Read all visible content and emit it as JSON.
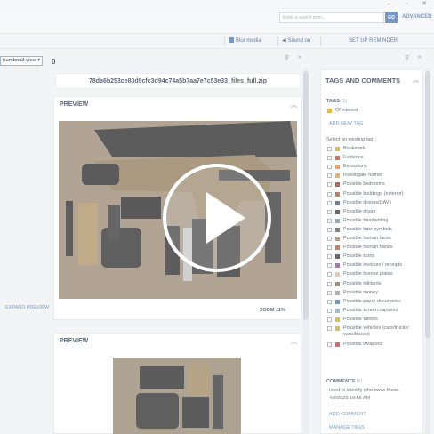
{
  "window": {
    "min": "–",
    "max": "▫",
    "close": "✕"
  },
  "search": {
    "placeholder": "Enter a search term...",
    "go_label": "GO",
    "advanced_label": "ADVANCED"
  },
  "toolbar": {
    "blur_media": "Blur media",
    "sound_on": "Sound on",
    "setup_reminder": "SET UP REMINDER"
  },
  "view_selector": {
    "value": "humbnail view"
  },
  "item_count": "0",
  "file": {
    "name": "78da6b253ce83d9cfc3d94c74a5b7aa7e7c53e33_files_full.zip"
  },
  "preview1": {
    "title": "PREVIEW",
    "expand_label": "EXPAND PREVIEW",
    "zoom_label": "ZOOM 11%"
  },
  "preview2": {
    "title": "PREVIEW"
  },
  "right_panel": {
    "title": "TAGS AND COMMENTS",
    "tags_label": "TAGS",
    "tags_count": "(1)",
    "applied_tag": "Of interest",
    "add_new_tag": "ADD NEW TAG",
    "select_existing": "Select an existing tag:",
    "tags": [
      {
        "label": "Bookmark",
        "color": "#d4a017"
      },
      {
        "label": "Evidence",
        "color": "#c0392b"
      },
      {
        "label": "Exceptions",
        "color": "#e67e22"
      },
      {
        "label": "Investigate further",
        "color": "#c9a227"
      },
      {
        "label": "Possible bedrooms",
        "color": "#8e2c2c"
      },
      {
        "label": "Possible buildings (exterior)",
        "color": "#8b5a2b"
      },
      {
        "label": "Possible drones/UAVs",
        "color": "#3b4c6b"
      },
      {
        "label": "Possible drugs",
        "color": "#2c2c2c"
      },
      {
        "label": "Possible handwriting",
        "color": "#6b8e9e"
      },
      {
        "label": "Possible hate symbols",
        "color": "#555555"
      },
      {
        "label": "Possible human faces",
        "color": "#9e7b5a"
      },
      {
        "label": "Possible human hands",
        "color": "#a05a2c"
      },
      {
        "label": "Possible icons",
        "color": "#2c2c2c"
      },
      {
        "label": "Possible invoices / receipts",
        "color": "#7b4a8e"
      },
      {
        "label": "Possible license plates",
        "color": "#d8b4a0"
      },
      {
        "label": "Possible militants",
        "color": "#6b6b3b"
      },
      {
        "label": "Possible money",
        "color": "#8e8e8e"
      },
      {
        "label": "Possible paper documents",
        "color": "#3b6ea5"
      },
      {
        "label": "Possible screen captures",
        "color": "#7fa3c7"
      },
      {
        "label": "Possible tattoos",
        "color": "#d4a017"
      },
      {
        "label": "Possible vehicles (cars/trucks/ vans/buses)",
        "color": "#c9a227"
      },
      {
        "label": "Possible weapons",
        "color": "#c0392b"
      }
    ],
    "comments_label": "COMMENTS",
    "comments_count": "(1)",
    "comment_text": "need to identify who owns these.",
    "comment_time": "4/8/2023 10:55 AM",
    "add_comment": "ADD COMMENT",
    "manage_tags": "MANAGE TAGS"
  },
  "colors": {
    "accent": "#3f6fb0",
    "link": "#4a72b0",
    "applied_tag": "#d4a017"
  },
  "icons": [
    "pin-icon",
    "forward-icon",
    "collapse-icon",
    "play-icon",
    "sound-icon",
    "blur-icon"
  ]
}
